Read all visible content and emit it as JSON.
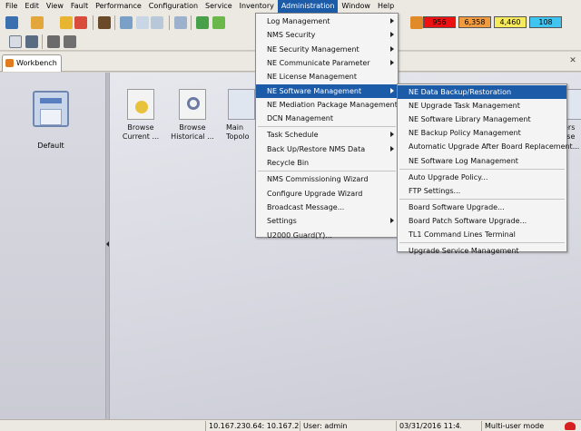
{
  "menubar": [
    "File",
    "Edit",
    "View",
    "Fault",
    "Performance",
    "Configuration",
    "Service",
    "Inventory",
    "Administration",
    "Window",
    "Help"
  ],
  "alarms": [
    {
      "value": "956",
      "color": "#ee1111"
    },
    {
      "value": "6,358",
      "color": "#f19b40"
    },
    {
      "value": "4,460",
      "color": "#f6e95a"
    },
    {
      "value": "108",
      "color": "#40c4f0"
    }
  ],
  "tab": {
    "label": "Workbench"
  },
  "left": {
    "default_label": "Default"
  },
  "desktop": [
    {
      "label": "Browse\nCurrent ...",
      "icon": "browse-current-alarm-icon"
    },
    {
      "label": "Browse\nHistorical ...",
      "icon": "browse-historical-alarm-icon"
    },
    {
      "label": "Main\nTopolo",
      "icon": "main-topology-icon"
    },
    {
      "label": "ers\nrse",
      "icon": "partial-icon"
    }
  ],
  "admin_menu": [
    {
      "label": "Log Management",
      "sub": true
    },
    {
      "label": "NMS Security",
      "sub": true
    },
    {
      "label": "NE Security Management",
      "sub": true
    },
    {
      "label": "NE Communicate Parameter",
      "sub": true
    },
    {
      "label": "NE License Management",
      "sub": false
    },
    {
      "label": "NE Software Management",
      "sub": true,
      "hl": true
    },
    {
      "label": "NE Mediation Package Management",
      "sub": false
    },
    {
      "label": "DCN Management",
      "sub": false
    },
    {
      "sep": true
    },
    {
      "label": "Task Schedule",
      "sub": true
    },
    {
      "label": "Back Up/Restore NMS Data",
      "sub": true
    },
    {
      "label": "Recycle Bin",
      "sub": false
    },
    {
      "sep": true
    },
    {
      "label": "NMS Commissioning Wizard",
      "sub": false
    },
    {
      "label": "Configure Upgrade Wizard",
      "sub": false
    },
    {
      "label": "Broadcast Message...",
      "sub": false
    },
    {
      "label": "Settings",
      "sub": true
    },
    {
      "label": "U2000 Guard(Y)...",
      "sub": false
    }
  ],
  "sub_menu": [
    {
      "label": "NE Data Backup/Restoration",
      "hl": true
    },
    {
      "label": "NE Upgrade Task Management"
    },
    {
      "label": "NE Software Library Management"
    },
    {
      "label": "NE Backup Policy Management"
    },
    {
      "label": "Automatic Upgrade After Board Replacement..."
    },
    {
      "label": "NE Software Log Management"
    },
    {
      "sep": true
    },
    {
      "label": "Auto Upgrade Policy..."
    },
    {
      "label": "FTP Settings..."
    },
    {
      "sep": true
    },
    {
      "label": "Board Software Upgrade..."
    },
    {
      "label": "Board Patch Software Upgrade..."
    },
    {
      "label": "TL1 Command Lines Terminal"
    },
    {
      "sep": true
    },
    {
      "label": "Upgrade Service Management"
    }
  ],
  "status": {
    "server": "10.167.230.64: 10.167.230...",
    "user": "User: admin",
    "datetime": "03/31/2016 11:4...",
    "mode": "Multi-user mode"
  },
  "colors": {
    "accent": "#1c5ba8"
  }
}
